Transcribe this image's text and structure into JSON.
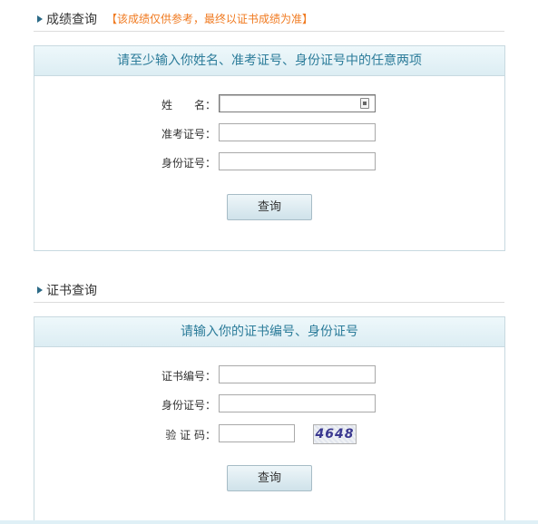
{
  "score_section": {
    "title": "成绩查询",
    "note": "【该成绩仅供参考，最终以证书成绩为准】",
    "panel_header": "请至少输入你姓名、准考证号、身份证号中的任意两项",
    "fields": [
      {
        "label": "姓　　名：",
        "value": "",
        "placeholder": ""
      },
      {
        "label": "准考证号：",
        "value": "",
        "placeholder": ""
      },
      {
        "label": "身份证号：",
        "value": "",
        "placeholder": ""
      }
    ],
    "query_button": "查询"
  },
  "cert_section": {
    "title": "证书查询",
    "panel_header": "请输入你的证书编号、身份证号",
    "fields": [
      {
        "label": "证书编号：",
        "value": "",
        "placeholder": ""
      },
      {
        "label": "身份证号：",
        "value": "",
        "placeholder": ""
      },
      {
        "label": "验 证 码：",
        "value": "",
        "placeholder": ""
      }
    ],
    "captcha_text": "4648",
    "query_button": "查询"
  },
  "colors": {
    "accent_text": "#2c7c9a",
    "note_text": "#f07a20",
    "panel_header_bg": "#dcedf3"
  }
}
